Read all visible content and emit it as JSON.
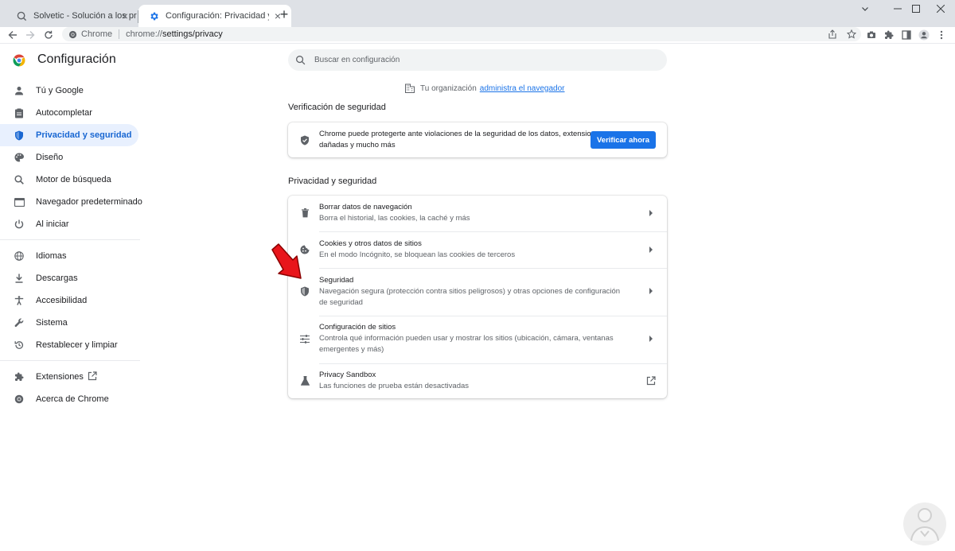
{
  "browser": {
    "tabs": [
      {
        "label": "Solvetic - Solución a los problemas"
      },
      {
        "label": "Configuración: Privacidad y seguridad"
      }
    ],
    "new_tab_symbol": "+",
    "close_symbol": "×",
    "omnibox": {
      "chip_label": "Chrome",
      "url_scheme": "chrome://",
      "url_path": "settings/privacy"
    }
  },
  "settings": {
    "title": "Configuración",
    "search_placeholder": "Buscar en configuración",
    "sidebar": {
      "items": [
        {
          "label": "Tú y Google",
          "icon": "person-icon"
        },
        {
          "label": "Autocompletar",
          "icon": "clipboard-icon"
        },
        {
          "label": "Privacidad y seguridad",
          "icon": "shield-icon",
          "selected": true
        },
        {
          "label": "Diseño",
          "icon": "palette-icon"
        },
        {
          "label": "Motor de búsqueda",
          "icon": "search-icon"
        },
        {
          "label": "Navegador predeterminado",
          "icon": "browser-icon"
        },
        {
          "label": "Al iniciar",
          "icon": "power-icon"
        },
        {
          "label": "Idiomas",
          "icon": "globe-icon"
        },
        {
          "label": "Descargas",
          "icon": "download-icon"
        },
        {
          "label": "Accesibilidad",
          "icon": "accessibility-icon"
        },
        {
          "label": "Sistema",
          "icon": "wrench-icon"
        },
        {
          "label": "Restablecer y limpiar",
          "icon": "reset-icon"
        },
        {
          "label": "Extensiones",
          "icon": "puzzle-icon"
        },
        {
          "label": "Acerca de Chrome",
          "icon": "chrome-icon"
        }
      ]
    },
    "org_notice": {
      "text": "Tu organización",
      "link": "administra el navegador"
    },
    "safety_check": {
      "section_title": "Verificación de seguridad",
      "line1": "Chrome puede protegerte ante violaciones de la seguridad de los datos, extensiones",
      "line2": "dañadas y mucho más",
      "button_label": "Verificar ahora"
    },
    "privacy": {
      "section_title": "Privacidad y seguridad",
      "rows": [
        {
          "title": "Borrar datos de navegación",
          "subtitle": "Borra el historial, las cookies, la caché y más"
        },
        {
          "title": "Cookies y otros datos de sitios",
          "subtitle": "En el modo Incógnito, se bloquean las cookies de terceros"
        },
        {
          "title": "Seguridad",
          "subtitle": "Navegación segura (protección contra sitios peligrosos) y otras opciones de configuración de seguridad"
        },
        {
          "title": "Configuración de sitios",
          "subtitle": "Controla qué información pueden usar y mostrar los sitios (ubicación, cámara, ventanas emergentes y más)"
        },
        {
          "title": "Privacy Sandbox",
          "subtitle": "Las funciones de prueba están desactivadas"
        }
      ]
    }
  },
  "colors": {
    "accent": "#1a73e8",
    "selected_bg": "#e8f0fe",
    "arrow_red": "#e8151b"
  }
}
